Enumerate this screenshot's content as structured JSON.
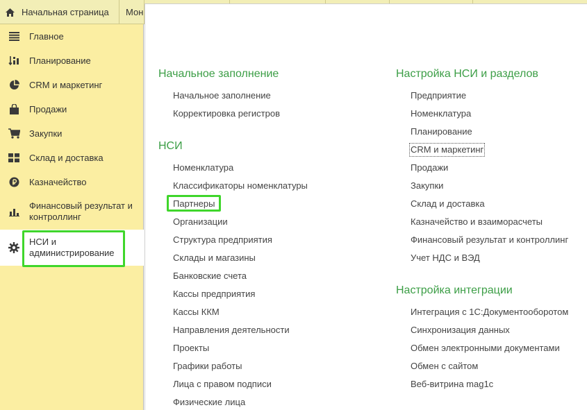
{
  "tabs": {
    "home_label": "Начальная страница",
    "second_label": "Мон"
  },
  "sidebar": {
    "items": [
      {
        "label": "Главное",
        "icon": "list-icon"
      },
      {
        "label": "Планирование",
        "icon": "sort-chart-icon"
      },
      {
        "label": "CRM и маркетинг",
        "icon": "pie-chart-icon"
      },
      {
        "label": "Продажи",
        "icon": "shopping-bag-icon"
      },
      {
        "label": "Закупки",
        "icon": "cart-icon"
      },
      {
        "label": "Склад и доставка",
        "icon": "grid-icon"
      },
      {
        "label": "Казначейство",
        "icon": "ruble-coin-icon"
      },
      {
        "label": "Финансовый результат и контроллинг",
        "icon": "bar-chart-icon"
      },
      {
        "label": "НСИ и администрирование",
        "icon": "gear-icon"
      }
    ],
    "active_index": 8
  },
  "content": {
    "col1": {
      "sections": [
        {
          "title": "Начальное заполнение",
          "links": [
            "Начальное заполнение",
            "Корректировка регистров"
          ]
        },
        {
          "title": "НСИ",
          "links": [
            "Номенклатура",
            "Классификаторы номенклатуры",
            "Партнеры",
            "Организации",
            "Структура предприятия",
            "Склады и магазины",
            "Банковские счета",
            "Кассы предприятия",
            "Кассы ККМ",
            "Направления деятельности",
            "Проекты",
            "Графики работы",
            "Лица с правом подписи",
            "Физические лица"
          ]
        }
      ]
    },
    "col2": {
      "sections": [
        {
          "title": "Настройка НСИ и разделов",
          "links": [
            "Предприятие",
            "Номенклатура",
            "Планирование",
            "CRM и маркетинг",
            "Продажи",
            "Закупки",
            "Склад и доставка",
            "Казначейство и взаиморасчеты",
            "Финансовый результат и контроллинг",
            "Учет НДС и ВЭД"
          ]
        },
        {
          "title": "Настройка интеграции",
          "links": [
            "Интеграция с 1С:Документооборотом",
            "Синхронизация данных",
            "Обмен электронными документами",
            "Обмен с сайтом",
            "Веб-витрина mag1c"
          ]
        }
      ]
    }
  },
  "colors": {
    "accent_green": "#3c9e46",
    "highlight_green": "#3fd62b",
    "sidebar_bg": "#fbeea2",
    "tab_bg": "#f2eeb6"
  }
}
